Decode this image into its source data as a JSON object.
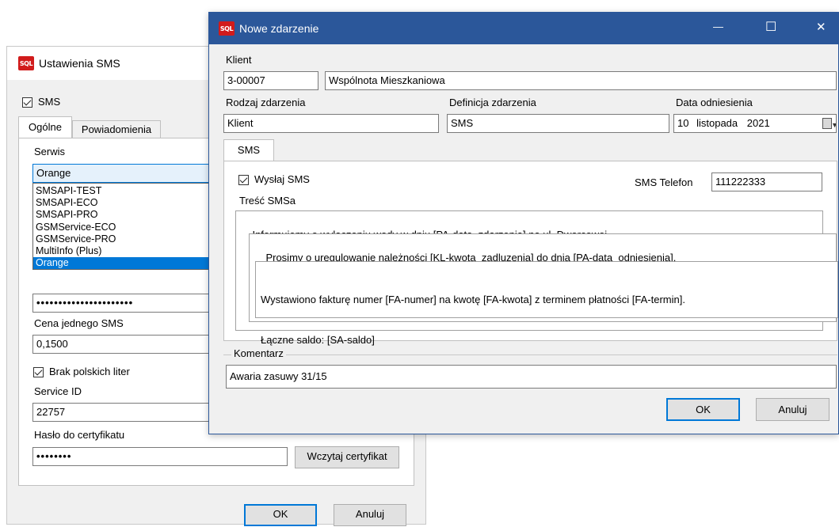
{
  "app_icon_text": "SQL",
  "sms_window": {
    "title": "Ustawienia SMS",
    "sms_checkbox": "SMS",
    "tabs": [
      "Ogólne",
      "Powiadomienia"
    ],
    "serwis_label": "Serwis",
    "serwis_value": "Orange",
    "serwis_options": [
      "SMSAPI-TEST",
      "SMSAPI-ECO",
      "SMSAPI-PRO",
      "GSMService-ECO",
      "GSMService-PRO",
      "MultiInfo (Plus)",
      "Orange"
    ],
    "password_value": "••••••••••••••••••••••",
    "cena_label": "Cena jednego SMS",
    "cena_value": "0,1500",
    "brak_label": "Brak polskich liter",
    "service_id_label": "Service ID",
    "service_id_value": "22757",
    "haslo_label": "Hasło do certyfikatu",
    "haslo_value": "••••••••",
    "wczytaj_button": "Wczytaj certyfikat",
    "ok_button": "OK",
    "anuluj_button": "Anuluj"
  },
  "event_window": {
    "title": "Nowe zdarzenie",
    "controls": {
      "minimize": "—",
      "maximize": "☐",
      "close": "✕"
    },
    "klient_label": "Klient",
    "klient_code": "3-00007",
    "klient_name": "Wspólnota Mieszkaniowa",
    "rodzaj_label": "Rodzaj zdarzenia",
    "rodzaj_value": "Klient",
    "definicja_label": "Definicja zdarzenia",
    "definicja_value": "SMS",
    "data_label": "Data odniesienia",
    "data_day": "10",
    "data_month": "listopada",
    "data_year": "2021",
    "tab_sms": "SMS",
    "wyslij_label": "Wysłaj SMS",
    "telefon_label": "SMS Telefon",
    "telefon_value": "111222333",
    "tresc_label": "Treść SMSa",
    "tresc_line1": "Informujemy o wyłączeniu wody w dniu [PA-data_zdarzenia] na ul. Dworcowej.",
    "tresc_line2": "Prosimy o uregulowanie należności [KL-kwota_zadluzenia] do dnia [PA-data_odniesienia].",
    "tresc_line3": "Wystawiono fakturę numer [FA-numer] na kwotę [FA-kwota] z terminem płatności [FA-termin].",
    "tresc_line4": "Łączne saldo: [SA-saldo]",
    "komentarz_label": "Komentarz",
    "komentarz_value": "Awaria zasuwy 31/15",
    "ok_button": "OK",
    "anuluj_button": "Anuluj"
  },
  "colors": {
    "title_active": "#2b579a",
    "accent": "#0078d7"
  }
}
